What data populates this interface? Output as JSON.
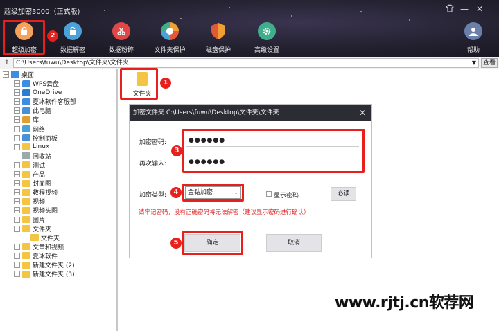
{
  "app": {
    "title": "超级加密3000（正式版)"
  },
  "window_controls": [
    "shirt-icon",
    "minimize-icon",
    "maximize-icon",
    "close-icon"
  ],
  "toolbar": {
    "items": [
      {
        "label": "超级加密",
        "icon": "lock-icon",
        "color": "#f5a25c"
      },
      {
        "label": "数据解密",
        "icon": "unlock-icon",
        "color": "#4aa3d8"
      },
      {
        "label": "数据粉碎",
        "icon": "scissors-icon",
        "color": "#e04848"
      },
      {
        "label": "文件夹保护",
        "icon": "shutter-icon",
        "color": "#f0a030"
      },
      {
        "label": "磁盘保护",
        "icon": "shield-icon",
        "color": "#e05a3a"
      },
      {
        "label": "高级设置",
        "icon": "gear-icon",
        "color": "#3fae8a"
      },
      {
        "label": "帮助",
        "icon": "user-icon",
        "color": "#6a7faa"
      }
    ]
  },
  "path_bar": {
    "up": "↑",
    "path": "C:\\Users\\fuwu\\Desktop\\文件夹\\文件夹",
    "view_label": "查看"
  },
  "tree": {
    "root": "桌面",
    "items": [
      "WPS云盘",
      "OneDrive",
      "夏冰软件客服部",
      "此电脑",
      "库",
      "网络",
      "控制面板",
      "Linux",
      "回收站",
      "测试",
      "产品",
      "封面图",
      "教程视频",
      "视频",
      "视频头图",
      "图片",
      "文件夹",
      "文件夹",
      "文章和视频",
      "夏冰软件",
      "新建文件夹 (2)",
      "新建文件夹 (3)"
    ]
  },
  "folder_tile": {
    "label": "文件夹"
  },
  "dialog": {
    "title": "加密文件夹 C:\\Users\\fuwu\\Desktop\\文件夹\\文件夹",
    "password_label": "加密密码:",
    "password_value": "●●●●●●",
    "confirm_label": "再次输入:",
    "confirm_value": "●●●●●●",
    "type_label": "加密类型:",
    "type_value": "金钻加密",
    "show_password_label": "显示密码",
    "must_read_label": "必读",
    "warning": "请牢记密码，没有正确密码将无法解密（建议显示密码进行确认）",
    "ok_label": "确定",
    "cancel_label": "取消"
  },
  "steps": [
    "1",
    "2",
    "3",
    "4",
    "5"
  ],
  "watermark": "www.rjtj.cn软荐网",
  "colors": {
    "accent_red": "#e8201d",
    "header_dark": "#22202e"
  }
}
